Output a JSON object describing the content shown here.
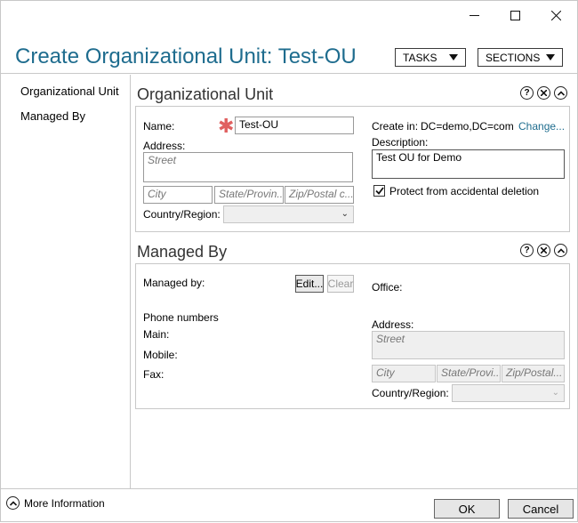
{
  "window": {
    "minimize_icon": "minimize-icon",
    "maximize_icon": "maximize-icon",
    "close_icon": "close-icon"
  },
  "header": {
    "title": "Create Organizational Unit: Test-OU",
    "tasks_label": "TASKS",
    "sections_label": "SECTIONS",
    "title_color": "#1e6c8e"
  },
  "nav": {
    "items": [
      {
        "label": "Organizational Unit"
      },
      {
        "label": "Managed By"
      }
    ]
  },
  "ou_section": {
    "title": "Organizational Unit",
    "name_label": "Name:",
    "name_value": "Test-OU",
    "address_label": "Address:",
    "street_placeholder": "Street",
    "city_placeholder": "City",
    "state_placeholder": "State/Provin...",
    "zip_placeholder": "Zip/Postal c...",
    "country_label": "Country/Region:",
    "create_in_label": "Create in:",
    "create_in_value": "DC=demo,DC=com",
    "change_link": "Change...",
    "description_label": "Description:",
    "description_value": "Test OU for Demo",
    "protect_label": "Protect from accidental deletion",
    "protect_checked": true
  },
  "managed_section": {
    "title": "Managed By",
    "managed_by_label": "Managed by:",
    "edit_label": "Edit...",
    "clear_label": "Clear",
    "office_label": "Office:",
    "phone_numbers_label": "Phone numbers",
    "main_label": "Main:",
    "mobile_label": "Mobile:",
    "fax_label": "Fax:",
    "address_label": "Address:",
    "street_placeholder": "Street",
    "city_placeholder": "City",
    "state_placeholder": "State/Provi...",
    "zip_placeholder": "Zip/Postal...",
    "country_label": "Country/Region:"
  },
  "footer": {
    "more_info_label": "More Information",
    "ok_label": "OK",
    "cancel_label": "Cancel"
  }
}
